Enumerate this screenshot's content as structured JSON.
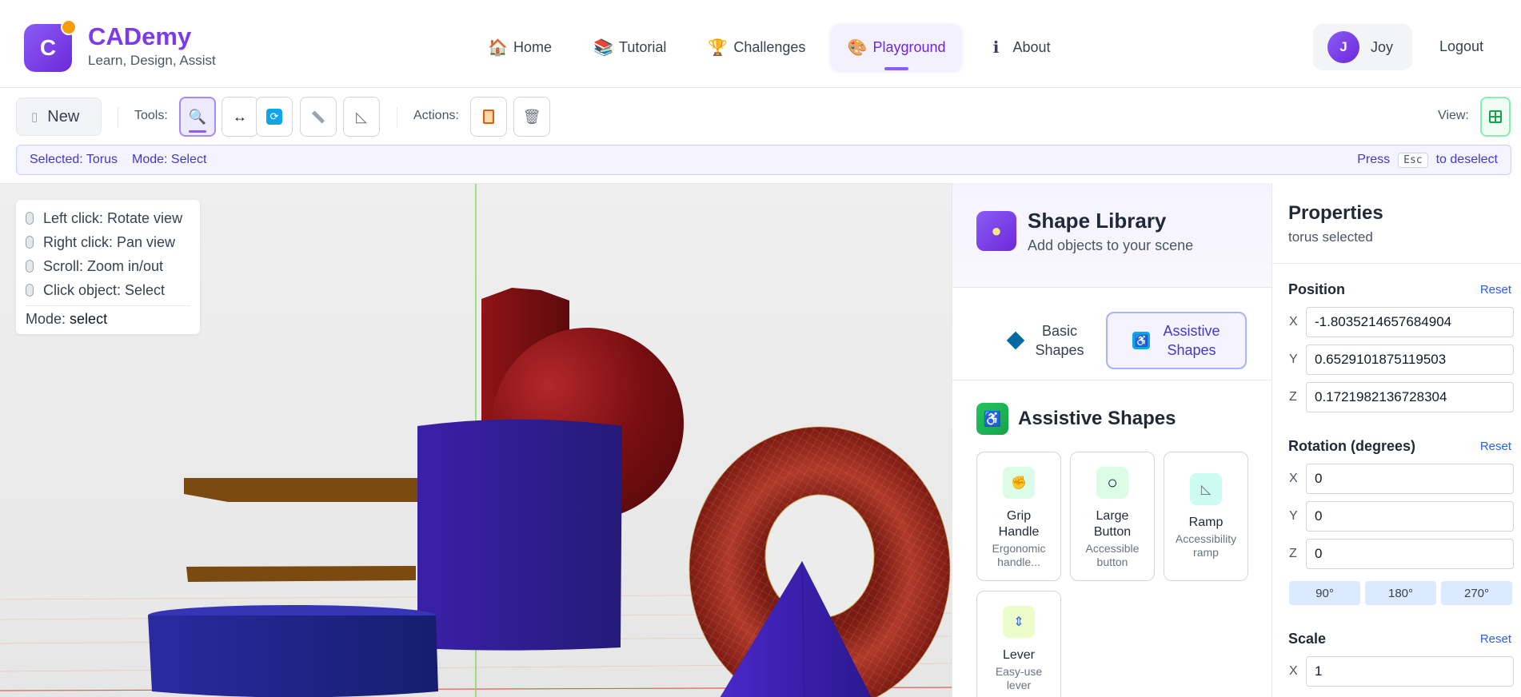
{
  "app": {
    "name": "CADemy",
    "tagline": "Learn, Design, Assist",
    "logo_letter": "C"
  },
  "nav": {
    "items": [
      {
        "label": "Home",
        "icon": "house-icon",
        "glyph": "🏠",
        "active": false
      },
      {
        "label": "Tutorial",
        "icon": "books-icon",
        "glyph": "📚",
        "active": false
      },
      {
        "label": "Challenges",
        "icon": "trophy-icon",
        "glyph": "🏆",
        "active": false
      },
      {
        "label": "Playground",
        "icon": "palette-icon",
        "glyph": "🎨",
        "active": true
      },
      {
        "label": "About",
        "icon": "info-icon",
        "glyph": "ℹ",
        "active": false
      }
    ]
  },
  "user": {
    "initial": "J",
    "name": "Joy",
    "logout_label": "Logout"
  },
  "toolbar": {
    "new_label": "New",
    "tools_label": "Tools:",
    "actions_label": "Actions:",
    "view_label": "View:"
  },
  "status": {
    "selected": "Selected: Torus",
    "mode": "Mode: Select",
    "hint_prefix": "Press",
    "hint_key": "Esc",
    "hint_suffix": "to deselect"
  },
  "viewport": {
    "help": [
      "Left click: Rotate view",
      "Right click: Pan view",
      "Scroll: Zoom in/out",
      "Click object: Select"
    ],
    "mode_label": "Mode:",
    "mode_value": "select"
  },
  "library": {
    "title": "Shape Library",
    "subtitle": "Add objects to your scene",
    "tabs": [
      {
        "line1": "Basic",
        "line2": "Shapes",
        "active": false
      },
      {
        "line1": "Assistive",
        "line2": "Shapes",
        "active": true
      }
    ],
    "section_title": "Assistive Shapes",
    "cards": [
      {
        "name_line1": "Grip",
        "name_line2": "Handle",
        "desc_line1": "Ergonomic",
        "desc_line2": "handle...",
        "icon": "grip-hand-icon",
        "glyph": "✊",
        "bg": "#dcfce7"
      },
      {
        "name_line1": "Large",
        "name_line2": "Button",
        "desc_line1": "Accessible",
        "desc_line2": "button",
        "icon": "circle-button-icon",
        "glyph": "○",
        "bg": "#dcfce7"
      },
      {
        "name_line1": "Ramp",
        "name_line2": "",
        "desc_line1": "Accessibility",
        "desc_line2": "ramp",
        "icon": "ramp-icon",
        "glyph": "◺",
        "bg": "#ccfbf1"
      },
      {
        "name_line1": "Lever",
        "name_line2": "",
        "desc_line1": "Easy-use",
        "desc_line2": "lever",
        "icon": "lever-icon",
        "glyph": "⇕",
        "bg": "#ecfccb"
      }
    ]
  },
  "properties": {
    "title": "Properties",
    "subtitle": "torus selected",
    "reset_label": "Reset",
    "position": {
      "title": "Position",
      "x": "-1.8035214657684904",
      "y": "0.6529101875119503",
      "z": "0.1721982136728304"
    },
    "rotation": {
      "title": "Rotation (degrees)",
      "x": "0",
      "y": "0",
      "z": "0",
      "presets": [
        "90°",
        "180°",
        "270°"
      ]
    },
    "scale": {
      "title": "Scale",
      "x": "1"
    },
    "axis": {
      "x": "X",
      "y": "Y",
      "z": "Z"
    }
  },
  "colors": {
    "accent": "#7c3aed",
    "red_object": "#8b1a1a",
    "blue_object": "#2a1c8c",
    "brown_object": "#7a4a12"
  }
}
